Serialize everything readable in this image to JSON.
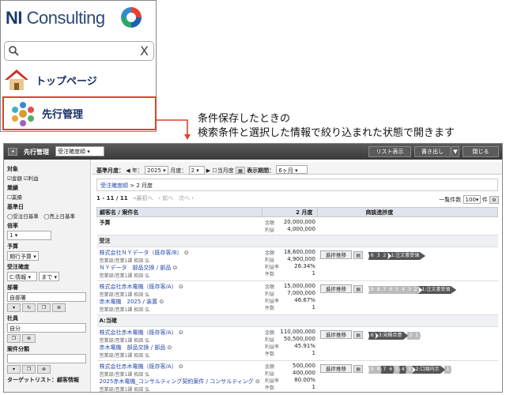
{
  "nav": {
    "logo_text_bold": "NI",
    "logo_text": " Consulting",
    "search_placeholder": "",
    "clear_symbol": "X",
    "top_label": "トップページ",
    "advance_label": "先行管理"
  },
  "callout": {
    "line1": "条件保存したときの",
    "line2": "検索条件と選択した情報で絞り込まれた状態で開きます"
  },
  "app": {
    "title": "先行管理",
    "view_select": "受注確度順",
    "buttons": [
      "リスト表示",
      "書き出し",
      "▼",
      "閉じる"
    ]
  },
  "sidebar": {
    "target_h": "対象",
    "target_opts": [
      "☑金額",
      "☑利益"
    ],
    "biz_h": "業績",
    "biz_opt": "☐業績",
    "base_h": "基準日",
    "base_opts": "◯受注日基準　◯売上日基準",
    "mult_h": "倍率",
    "mult_val": "1",
    "budget_h": "予算",
    "budget_val": "期行予算",
    "prob_h": "受注確度",
    "prob_from": "C:情報",
    "prob_to": "まで",
    "dept_h": "部署",
    "dept_val": "自部署",
    "emp_h": "社員",
    "emp_val": "自分",
    "case_h": "案件分類",
    "target_list_h": "ターゲットリスト：顧客情報"
  },
  "filter": {
    "base_month_label": "基準月度：",
    "year_label": "年：",
    "year_val": "2025",
    "month_label": "月度：",
    "month_val": "2",
    "current_month": "☐当月度",
    "period_label": "表示期間：",
    "period_val": "6ヶ月"
  },
  "crumb": {
    "link": "受注確度順",
    "sep": " > ",
    "current": "2 月度"
  },
  "pager": {
    "range": "1 - 11 / 11",
    "first": "«最初へ",
    "prev": "‹ 前へ",
    "next": "次へ ›",
    "per_label": "一覧件数",
    "per_val": "100",
    "per_unit": "件"
  },
  "columns": [
    "顧客名 / 案件名",
    "2 月度",
    "商談進捗度"
  ],
  "budget_row": {
    "label": "予算",
    "lines": [
      [
        "金額",
        "20,000,000"
      ],
      [
        "利益",
        "4,000,000"
      ]
    ]
  },
  "groups": [
    {
      "name": "受注",
      "deal": {
        "customer": "株式会社ＮＹデータ（既存客/B）",
        "sub1": "営業部/営業1課 栢田 弘",
        "project": "ＮＹデータ　部品交換 / 部品",
        "sub2": "営業部/営業1課 栢田 弘",
        "metrics": [
          [
            "金額",
            "18,600,000"
          ],
          [
            "利益",
            "4,900,000"
          ],
          [
            "利益率",
            "26.34%"
          ],
          [
            "件数",
            "1"
          ]
        ],
        "chips": [
          [
            "6",
            "d"
          ],
          [
            "3",
            "d"
          ],
          [
            "2",
            "d"
          ],
          [
            "1:注文書受領",
            "d"
          ]
        ]
      }
    },
    {
      "name": "",
      "deal": {
        "customer": "株式会社赤木電機（既存客/A）",
        "sub1": "営業部/営業1課 栢田 弘",
        "project": "赤木電機　2025 / 装置",
        "sub2": "営業部/営業1課 栢田 弘",
        "metrics": [
          [
            "金額",
            "15,000,000"
          ],
          [
            "利益",
            "7,000,000"
          ],
          [
            "利益率",
            "46.67%"
          ],
          [
            "件数",
            "1"
          ]
        ],
        "chips": [
          [
            "9",
            "l"
          ],
          [
            "8",
            "l"
          ],
          [
            "7",
            "l"
          ],
          [
            "6",
            "l"
          ],
          [
            "5",
            "l"
          ],
          [
            "4",
            "l"
          ],
          [
            "3",
            "l"
          ],
          [
            "2",
            "l"
          ],
          [
            "1:注文書受領",
            "d"
          ]
        ]
      }
    },
    {
      "name": "A:当確",
      "deal": {
        "customer": "株式会社赤木電機（既存客/A）",
        "sub1": "営業部/営業1課 栢田 弘",
        "project": "赤木電機　部品交換 / 部品",
        "sub2": "営業部/営業1課 栢田 弘",
        "metrics": [
          [
            "金額",
            "110,000,000"
          ],
          [
            "利益",
            "50,500,000"
          ],
          [
            "利益率",
            "45.91%"
          ],
          [
            "件数",
            "1"
          ]
        ],
        "chips": [
          [
            "6",
            "d"
          ],
          [
            "3:見積合意",
            "d"
          ],
          [
            "2",
            "l"
          ],
          [
            "1",
            "l"
          ]
        ]
      }
    },
    {
      "name": "",
      "deal": {
        "customer": "株式会社赤木電機（既存客/A）",
        "sub1": "営業部/営業1課 栢田 弘",
        "project": "2025赤木電機_コンサルティング契約案件 / コンサルティング",
        "sub2": "営業部/営業1課 栢田 弘",
        "metrics": [
          [
            "金額",
            "500,000"
          ],
          [
            "利益",
            "400,000"
          ],
          [
            "利益率",
            "80.00%"
          ],
          [
            "件数",
            "1"
          ]
        ],
        "chips": [
          [
            "9",
            "l"
          ],
          [
            "8",
            "l"
          ],
          [
            "7",
            "d"
          ],
          [
            "6",
            "d"
          ],
          [
            "5",
            "l"
          ],
          [
            "4",
            "d"
          ],
          [
            "3",
            "l"
          ],
          [
            "2:口頭内示",
            "d"
          ],
          [
            "1",
            "l"
          ]
        ]
      }
    }
  ],
  "progress_btn": "進捗推移"
}
